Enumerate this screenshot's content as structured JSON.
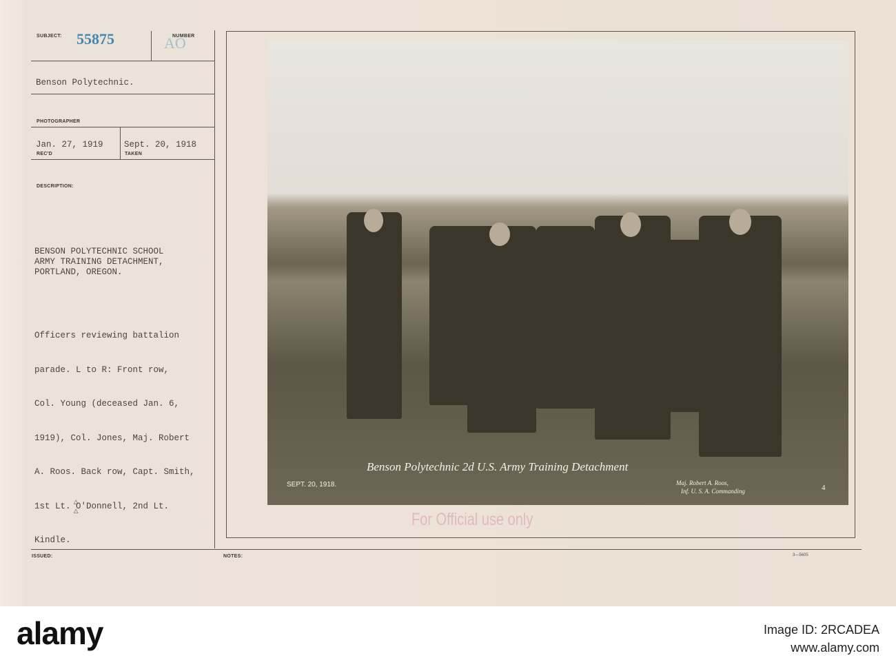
{
  "card": {
    "subject_label": "SUBJECT:",
    "subject_number": "55875",
    "number_label": "NUMBER",
    "number_value": "AO",
    "title": "Benson Polytechnic.",
    "photographer_label": "PHOTOGRAPHER",
    "received_date": "Jan. 27, 1919",
    "received_label": "REC'D",
    "taken_date": "Sept. 20, 1918",
    "taken_label": "TAKEN",
    "description_label": "DESCRIPTION:",
    "description_heading": [
      "BENSON POLYTECHNIC SCHOOL",
      "ARMY TRAINING DETACHMENT,",
      "PORTLAND, OREGON."
    ],
    "description_body": [
      "Officers reviewing battalion",
      "parade. L to R: Front row,",
      "Col. Young (deceased Jan. 6,",
      "1919), Col. Jones, Maj. Robert",
      "A. Roos. Back row, Capt. Smith,",
      "1st Lt. O'Donnell, 2nd Lt.",
      "Kindle."
    ],
    "issued_label": "ISSUED:",
    "notes_label": "NOTES:",
    "form_number": "3—5605",
    "margin_mark": "▷ ▷",
    "stamp": "For Official use only"
  },
  "photo": {
    "caption": "Benson Polytechnic 2d U.S. Army Training Detachment",
    "date": "Sept. 20, 1918.",
    "credit_line1": "Maj. Robert A. Roos,",
    "credit_line2": "Inf. U. S. A. Commanding",
    "plate_number": "4"
  },
  "footer": {
    "logo": "alamy",
    "image_id": "Image ID: 2RCADEA",
    "url": "www.alamy.com"
  },
  "colors": {
    "card": "#ebe1d5",
    "stamp_number": "#3f86b4",
    "stamp_official": "#e2b8bf"
  }
}
